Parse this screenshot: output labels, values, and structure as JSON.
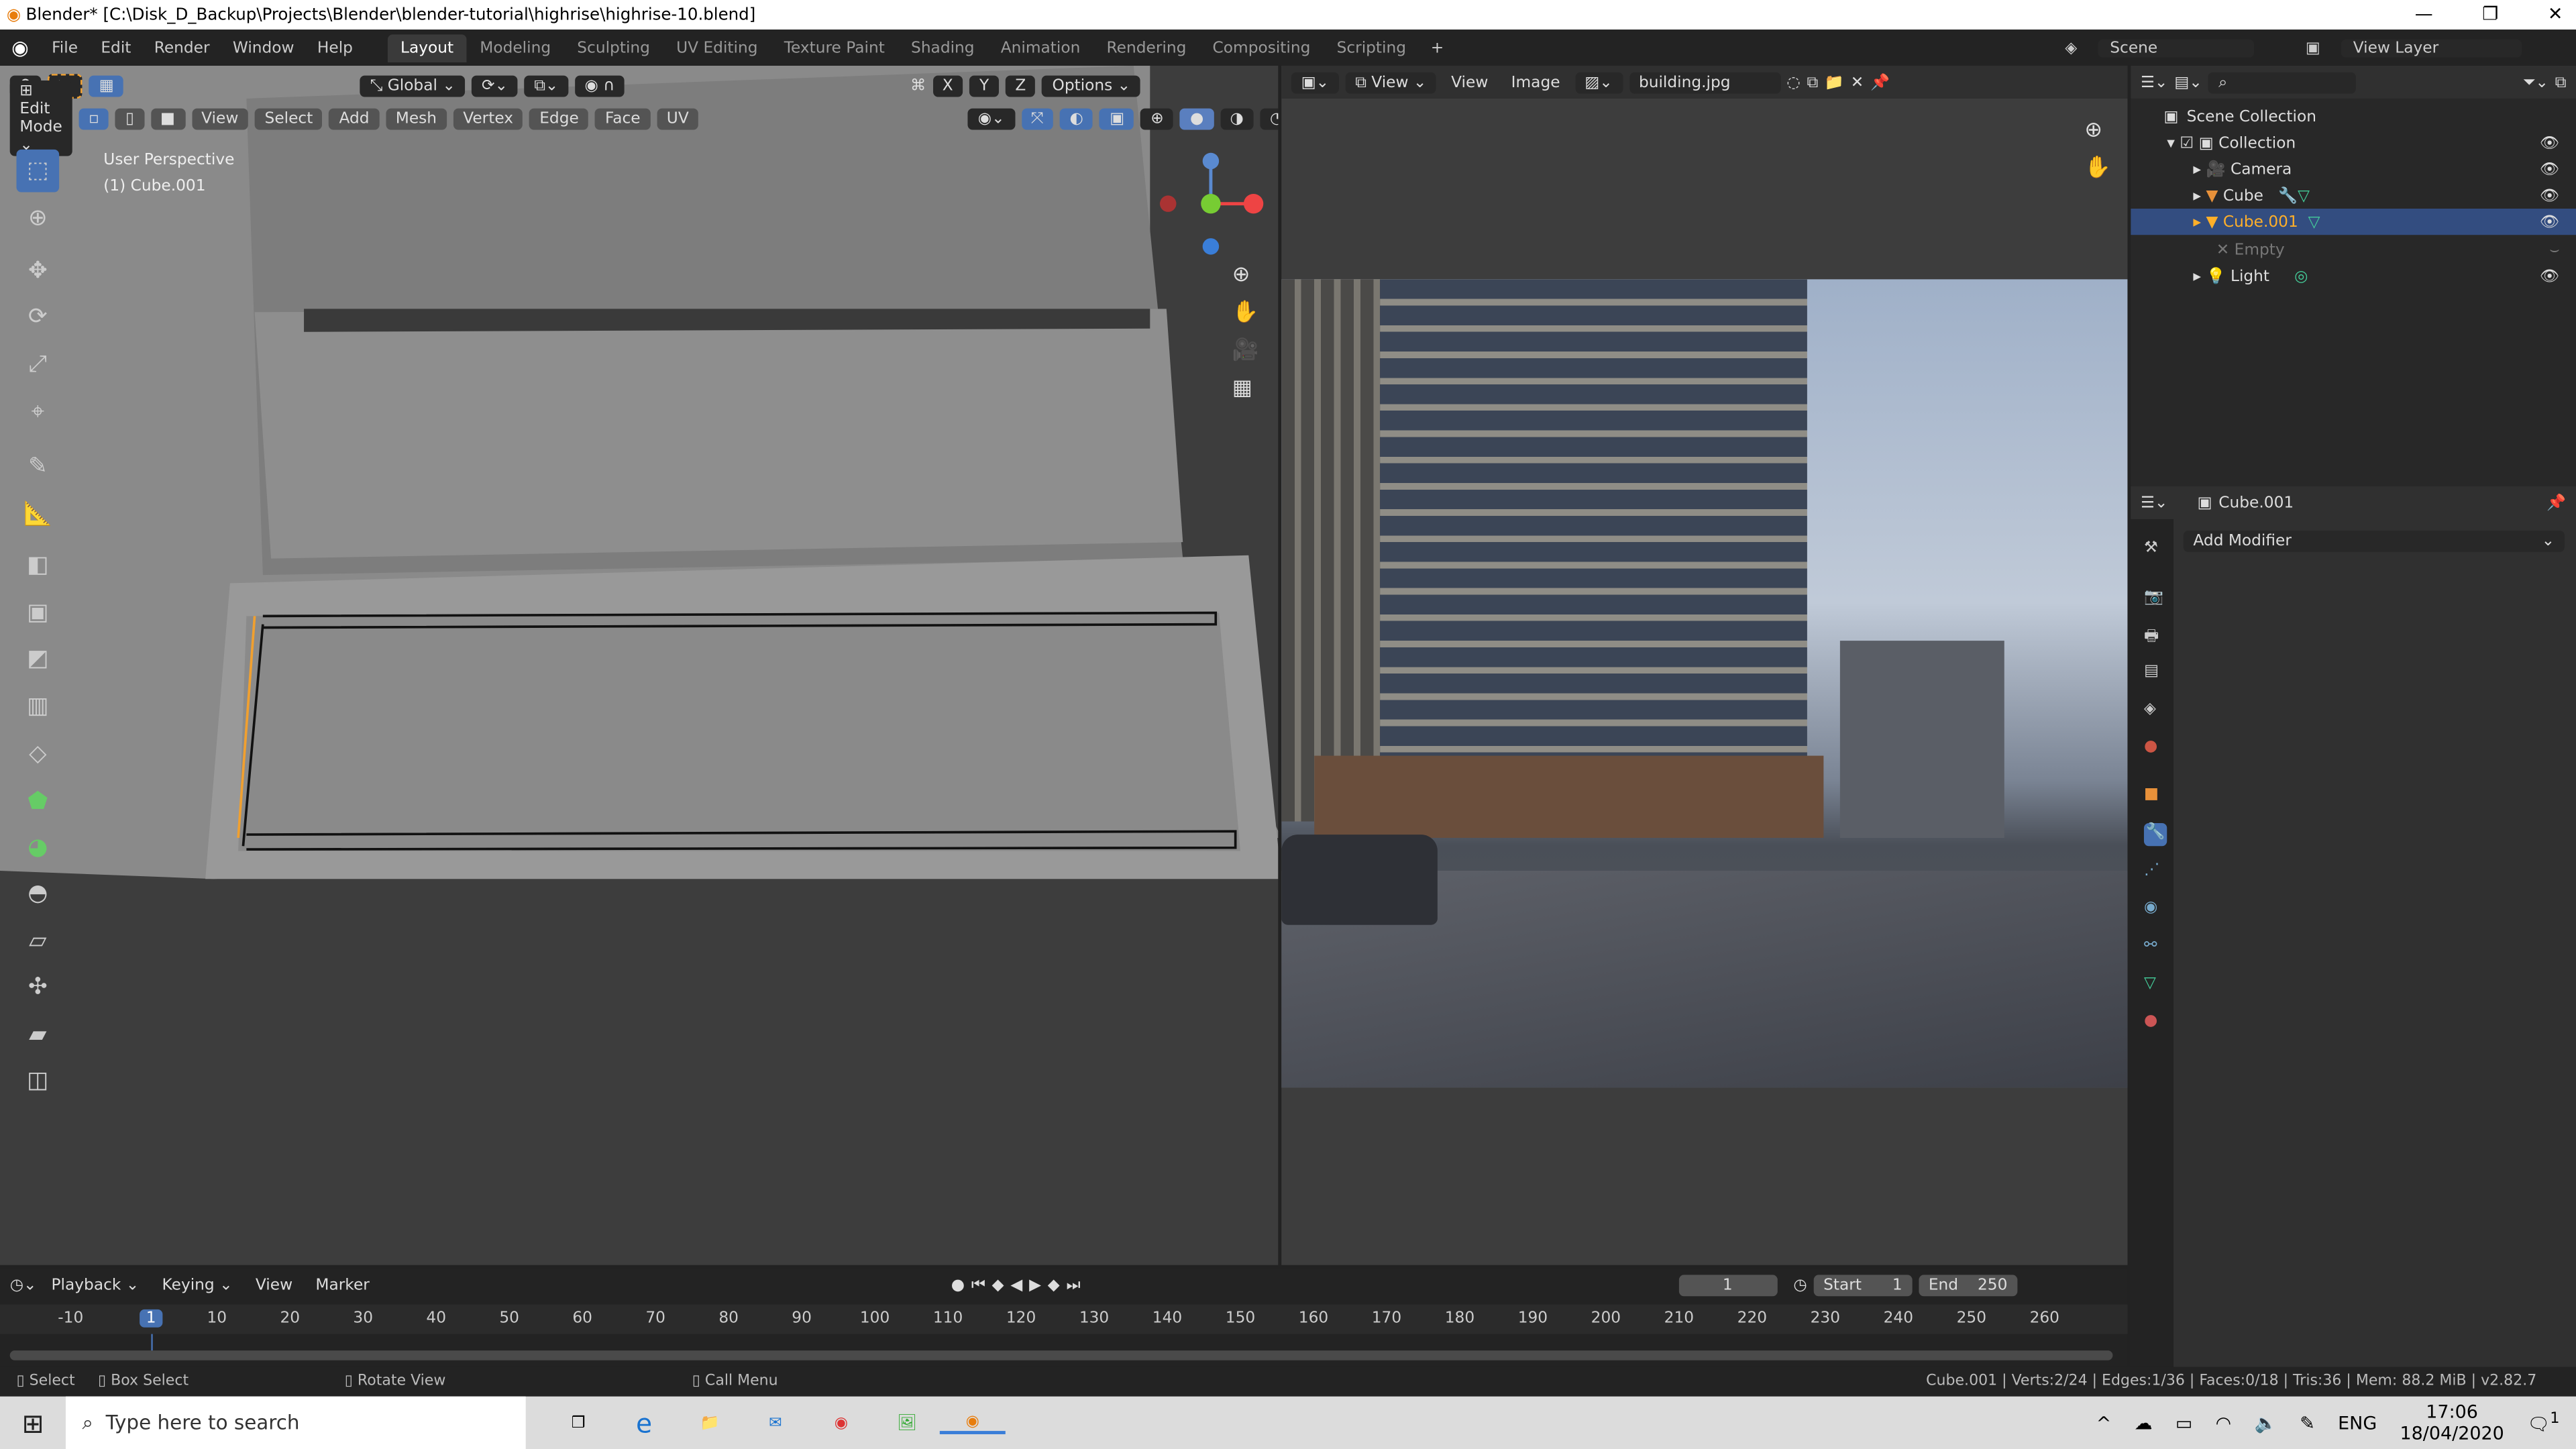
{
  "title": "Blender* [C:\\Disk_D_Backup\\Projects\\Blender\\blender-tutorial\\highrise\\highrise-10.blend]",
  "menu": [
    "File",
    "Edit",
    "Render",
    "Window",
    "Help"
  ],
  "workspaces": [
    "Layout",
    "Modeling",
    "Sculpting",
    "UV Editing",
    "Texture Paint",
    "Shading",
    "Animation",
    "Rendering",
    "Compositing",
    "Scripting"
  ],
  "active_workspace": "Layout",
  "viewport": {
    "orientation": "Global",
    "options": "Options",
    "mode": "Edit Mode",
    "menus": [
      "View",
      "Select",
      "Add",
      "Mesh",
      "Vertex",
      "Edge",
      "Face",
      "UV"
    ],
    "axes": [
      "X",
      "Y",
      "Z"
    ],
    "overlay_title": "User Perspective",
    "overlay_object": "(1) Cube.001"
  },
  "image_editor": {
    "menus": [
      "View",
      "View",
      "Image"
    ],
    "image_name": "building.jpg"
  },
  "top_right": {
    "scene": "Scene",
    "view_layer": "View Layer"
  },
  "outliner": {
    "root": "Scene Collection",
    "collection": "Collection",
    "items": [
      "Camera",
      "Cube",
      "Cube.001",
      "Empty",
      "Light"
    ],
    "selected": "Cube.001"
  },
  "properties": {
    "object": "Cube.001",
    "add_modifier": "Add Modifier"
  },
  "timeline": {
    "menus": [
      "Playback",
      "Keying",
      "View",
      "Marker"
    ],
    "current_frame": "1",
    "start_label": "Start",
    "start": "1",
    "end_label": "End",
    "end": "250",
    "ticks": [
      "-10",
      "1",
      "10",
      "20",
      "30",
      "40",
      "50",
      "60",
      "70",
      "80",
      "90",
      "100",
      "110",
      "120",
      "130",
      "140",
      "150",
      "160",
      "170",
      "180",
      "190",
      "200",
      "210",
      "220",
      "230",
      "240",
      "250",
      "260"
    ]
  },
  "status": {
    "select": "Select",
    "box_select": "Box Select",
    "rotate_view": "Rotate View",
    "call_menu": "Call Menu",
    "stats": "Cube.001 | Verts:2/24 | Edges:1/36 | Faces:0/18 | Tris:36 | Mem: 88.2 MiB | v2.82.7"
  },
  "taskbar": {
    "search_placeholder": "Type here to search",
    "lang": "ENG",
    "time": "17:06",
    "date": "18/04/2020",
    "notifications": "1"
  },
  "colors": {
    "accent": "#4772b3",
    "selected_orange": "#f0a030",
    "bg": "#3d3d3d"
  }
}
